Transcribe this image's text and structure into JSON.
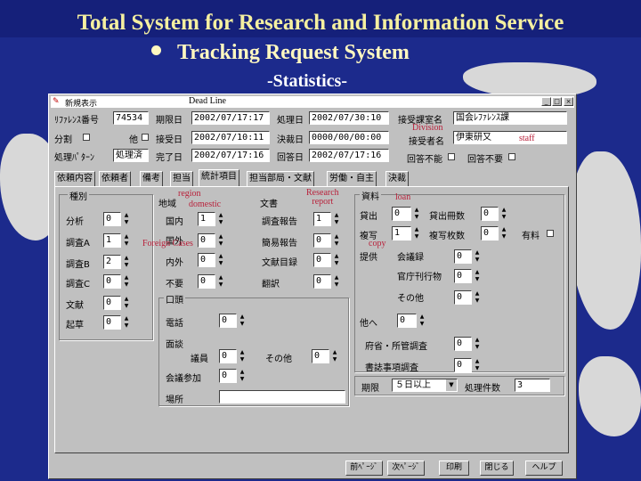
{
  "slide": {
    "title": "Total System for Research and Information Service",
    "subtitle": "Tracking Request System",
    "stats": "-Statistics-"
  },
  "window": {
    "app_name": "新規表示",
    "deadline_label": "Dead Line",
    "minimize": "_",
    "maximize": "□",
    "close": "×"
  },
  "form": {
    "ref_no_label": "ﾘﾌｧﾚﾝｽ番号",
    "ref_no_value": "74534",
    "split_label": "分割",
    "other_label": "他",
    "status_label": "処理ﾊﾟﾀｰﾝ",
    "status_value": "処理済",
    "deadline_date_label": "期限日",
    "deadline_date_value": "2002/07/17:17",
    "received_date_label": "接受日",
    "received_date_value": "2002/07/10:11",
    "completed_date_label": "完了日",
    "completed_date_value": "2002/07/17:16",
    "process_label": "処理日",
    "process_value": "2002/07/30:10",
    "decided_label": "決裁日",
    "decided_value": "0000/00/00:00",
    "reply_label": "回答日",
    "reply_value": "2002/07/17:16",
    "receiving_dept_label": "接受課室名",
    "receiving_dept_value": "国会ﾚﾌｧﾚﾝｽ課",
    "receiver_label": "接受者名",
    "receiver_value": "伊東研又",
    "division_annotation": "Division",
    "staff_annotation": "staff",
    "reply_impossible_label": "回答不能",
    "reply_unnecessary_label": "回答不要"
  },
  "tabs": [
    "依頼内容",
    "依頼者",
    "備考",
    "担当",
    "統計項目",
    "担当部局・文献",
    "労働・自主",
    "決裁"
  ],
  "stats": {
    "kind_group": "種別",
    "analysis_label": "分析",
    "analysis_value": "0",
    "survey_a_label": "調査A",
    "survey_a_value": "1",
    "survey_b_label": "調査B",
    "survey_b_value": "2",
    "survey_c_label": "調査C",
    "survey_c_value": "0",
    "literature_label": "文献",
    "literature_value": "0",
    "draft_label": "起草",
    "draft_value": "0",
    "region_group": "地域",
    "region_annotation": "region",
    "domestic_annotation": "domestic",
    "domestic_label": "国内",
    "domestic_value": "1",
    "foreign_label": "国外",
    "foreign_value": "0",
    "foreign_annotation": "Foreign Cases",
    "inside_label": "内外",
    "inside_value": "0",
    "none_label": "不要",
    "none_value": "0",
    "doc_group": "文書",
    "research_annotation": "Research\nreport",
    "research_label": "調査報告",
    "research_value": "1",
    "brief_label": "簡易報告",
    "brief_value": "0",
    "doclist_label": "文献目録",
    "doclist_value": "0",
    "translation_label": "翻訳",
    "translation_value": "0",
    "material_group": "資料",
    "loan_annotation": "loan",
    "copy_annotation": "copy",
    "loan_label": "貸出",
    "loan_value": "0",
    "loan_count_label": "貸出冊数",
    "loan_count_value": "0",
    "copy_label": "複写",
    "copy_value": "1",
    "copy_sheets_label": "複写枚数",
    "copy_sheets_value": "0",
    "paid_label": "有料",
    "provide_label": "提供",
    "meeting_record_label": "会議録",
    "meeting_record_value": "0",
    "official_label": "官庁刊行物",
    "official_value": "0",
    "other_label": "その他",
    "other_value": "0",
    "oral_group": "口頭",
    "phone_label": "電話",
    "phone_value": "0",
    "interview_label": "面談",
    "members_label": "議員",
    "members_value": "0",
    "others_label": "その他",
    "others_value": "0",
    "lecture_label": "会議参加",
    "lecture_value": "0",
    "place_label": "場所",
    "other_dept_label": "他へ",
    "other_dept_value": "0",
    "ministry_label": "府省・所管調査",
    "ministry_value": "0",
    "library_label": "書誌事項調査",
    "library_value": "0",
    "term_label": "期限",
    "term_value": "５日以上",
    "count_label": "処理件数",
    "count_value": "3"
  },
  "buttons": [
    "前ﾍﾟｰｼﾞ",
    "次ﾍﾟｰｼﾞ",
    "印刷",
    "閉じる",
    "ヘルプ"
  ]
}
